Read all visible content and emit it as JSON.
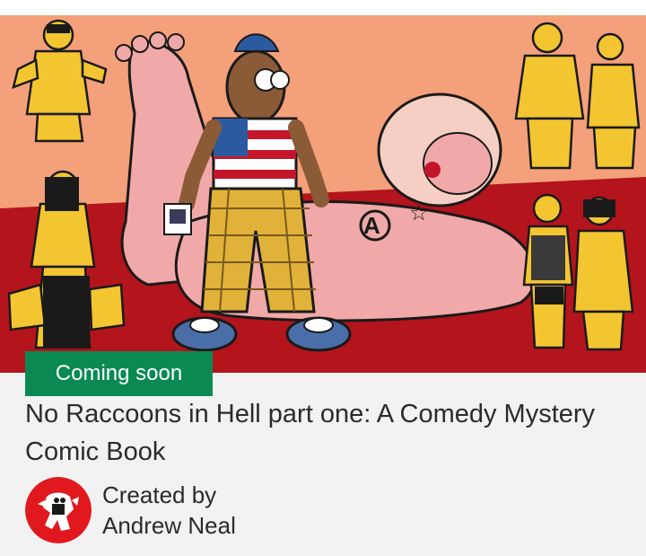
{
  "project": {
    "status_badge": "Coming soon",
    "title": "No Raccoons in Hell part one: A Comedy Mystery Comic Book",
    "creator_line1": "Created by",
    "creator_name": "Andrew Neal"
  },
  "colors": {
    "badge_bg": "#0a8a52",
    "hero_salmon": "#f4a07a",
    "hero_red": "#b4141c",
    "avatar_red": "#e1191f"
  },
  "icons": {
    "avatar": "creator-avatar-icon",
    "cover": "comic-cover-illustration"
  }
}
